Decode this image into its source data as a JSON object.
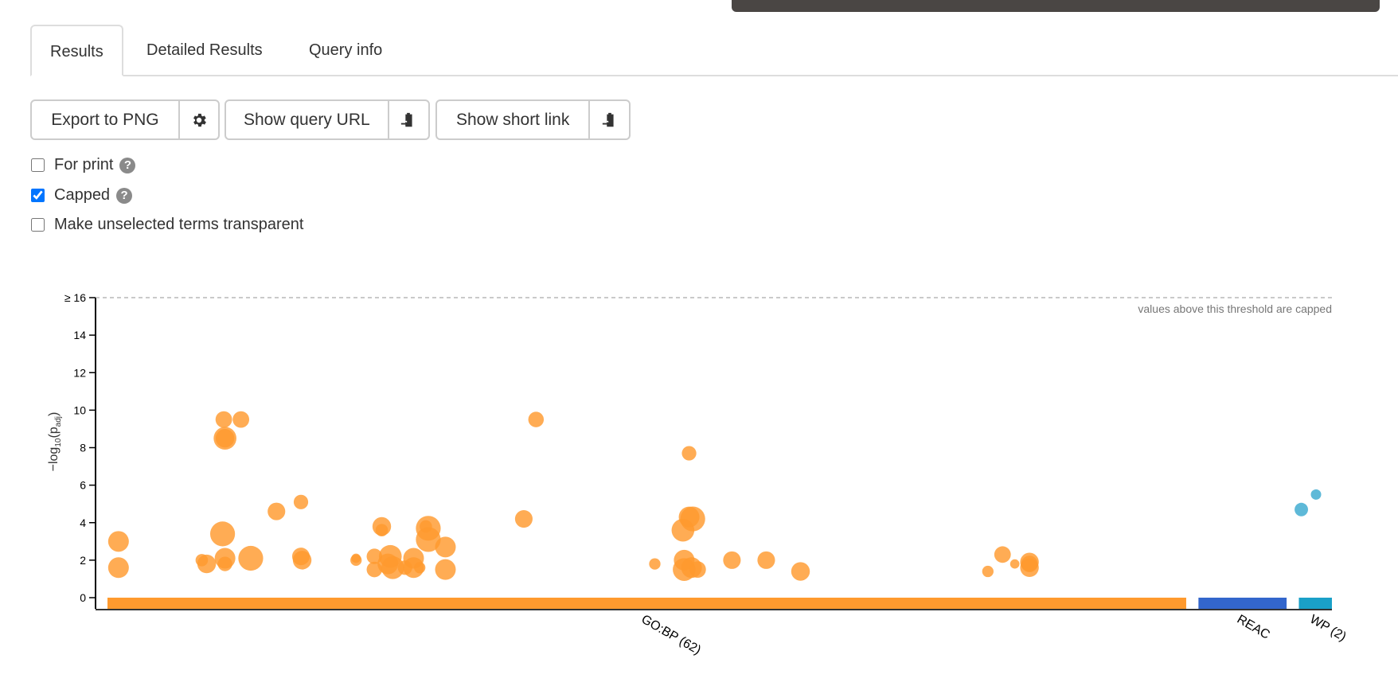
{
  "tabs": [
    {
      "label": "Results",
      "active": true
    },
    {
      "label": "Detailed Results",
      "active": false
    },
    {
      "label": "Query info",
      "active": false
    }
  ],
  "toolbar": {
    "export_label": "Export to PNG",
    "export_icon": "gear-icon",
    "query_url_label": "Show query URL",
    "query_url_icon": "clipboard-icon",
    "short_link_label": "Show short link",
    "short_link_icon": "clipboard-icon"
  },
  "options": {
    "for_print": {
      "label": "For print",
      "checked": false,
      "help": "?"
    },
    "capped": {
      "label": "Capped",
      "checked": true,
      "help": "?"
    },
    "transparent": {
      "label": "Make unselected terms transparent",
      "checked": false
    }
  },
  "chart_data": {
    "type": "scatter",
    "title": "",
    "ylabel": "-log10(p_adj)",
    "ylabel_main": "−log",
    "ylabel_sub": "10",
    "ylabel_paren": "(p",
    "ylabel_sub2": "adj",
    "ylabel_close": ")",
    "ylim": [
      0,
      16
    ],
    "yticks": [
      0,
      2,
      4,
      6,
      8,
      10,
      12,
      14,
      16
    ],
    "ytick_labels": [
      "0",
      "2",
      "4",
      "6",
      "8",
      "10",
      "12",
      "14",
      "≥ 16"
    ],
    "threshold": 16,
    "threshold_label": "values above this threshold are capped",
    "grid": false,
    "sources": [
      {
        "name": "GO:BP",
        "label": "GO:BP (62)",
        "color": "#ff9a2e",
        "start": 0.0,
        "end": 0.881
      },
      {
        "name": "REAC",
        "label": "REAC",
        "color": "#3366cc",
        "start": 0.891,
        "end": 0.963
      },
      {
        "name": "WP",
        "label": "WP (2)",
        "color": "#1aa0c8",
        "start": 0.973,
        "end": 1.0
      }
    ],
    "points": [
      {
        "source": "GO:BP",
        "x": 0.009,
        "y": 3.0,
        "size": 1.0
      },
      {
        "source": "GO:BP",
        "x": 0.009,
        "y": 1.6,
        "size": 1.0
      },
      {
        "source": "GO:BP",
        "x": 0.077,
        "y": 2.0,
        "size": 0.6
      },
      {
        "source": "GO:BP",
        "x": 0.081,
        "y": 1.8,
        "size": 0.9
      },
      {
        "source": "GO:BP",
        "x": 0.095,
        "y": 9.5,
        "size": 0.8
      },
      {
        "source": "GO:BP",
        "x": 0.096,
        "y": 8.5,
        "size": 1.1
      },
      {
        "source": "GO:BP",
        "x": 0.096,
        "y": 8.5,
        "size": 0.9
      },
      {
        "source": "GO:BP",
        "x": 0.094,
        "y": 3.4,
        "size": 1.2
      },
      {
        "source": "GO:BP",
        "x": 0.096,
        "y": 2.1,
        "size": 1.0
      },
      {
        "source": "GO:BP",
        "x": 0.096,
        "y": 1.8,
        "size": 0.7
      },
      {
        "source": "GO:BP",
        "x": 0.109,
        "y": 9.5,
        "size": 0.8
      },
      {
        "source": "GO:BP",
        "x": 0.117,
        "y": 2.1,
        "size": 1.2
      },
      {
        "source": "GO:BP",
        "x": 0.138,
        "y": 4.6,
        "size": 0.85
      },
      {
        "source": "GO:BP",
        "x": 0.158,
        "y": 5.1,
        "size": 0.7
      },
      {
        "source": "GO:BP",
        "x": 0.158,
        "y": 2.2,
        "size": 0.85
      },
      {
        "source": "GO:BP",
        "x": 0.159,
        "y": 2.0,
        "size": 0.9
      },
      {
        "source": "GO:BP",
        "x": 0.203,
        "y": 2.0,
        "size": 0.55
      },
      {
        "source": "GO:BP",
        "x": 0.203,
        "y": 2.1,
        "size": 0.45
      },
      {
        "source": "GO:BP",
        "x": 0.224,
        "y": 3.8,
        "size": 0.9
      },
      {
        "source": "GO:BP",
        "x": 0.224,
        "y": 3.6,
        "size": 0.6
      },
      {
        "source": "GO:BP",
        "x": 0.218,
        "y": 2.2,
        "size": 0.75
      },
      {
        "source": "GO:BP",
        "x": 0.218,
        "y": 1.5,
        "size": 0.75
      },
      {
        "source": "GO:BP",
        "x": 0.231,
        "y": 2.2,
        "size": 1.1
      },
      {
        "source": "GO:BP",
        "x": 0.233,
        "y": 1.6,
        "size": 1.1
      },
      {
        "source": "GO:BP",
        "x": 0.229,
        "y": 1.8,
        "size": 1.0
      },
      {
        "source": "GO:BP",
        "x": 0.243,
        "y": 1.6,
        "size": 0.7
      },
      {
        "source": "GO:BP",
        "x": 0.25,
        "y": 2.1,
        "size": 1.0
      },
      {
        "source": "GO:BP",
        "x": 0.25,
        "y": 1.6,
        "size": 1.0
      },
      {
        "source": "GO:BP",
        "x": 0.255,
        "y": 1.6,
        "size": 0.55
      },
      {
        "source": "GO:BP",
        "x": 0.262,
        "y": 3.7,
        "size": 1.2
      },
      {
        "source": "GO:BP",
        "x": 0.262,
        "y": 3.1,
        "size": 1.2
      },
      {
        "source": "GO:BP",
        "x": 0.26,
        "y": 3.8,
        "size": 0.6
      },
      {
        "source": "GO:BP",
        "x": 0.276,
        "y": 2.7,
        "size": 1.0
      },
      {
        "source": "GO:BP",
        "x": 0.276,
        "y": 1.5,
        "size": 1.0
      },
      {
        "source": "GO:BP",
        "x": 0.34,
        "y": 4.2,
        "size": 0.85
      },
      {
        "source": "GO:BP",
        "x": 0.35,
        "y": 9.5,
        "size": 0.75
      },
      {
        "source": "GO:BP",
        "x": 0.447,
        "y": 1.8,
        "size": 0.55
      },
      {
        "source": "GO:BP",
        "x": 0.475,
        "y": 7.7,
        "size": 0.7
      },
      {
        "source": "GO:BP",
        "x": 0.47,
        "y": 3.6,
        "size": 1.1
      },
      {
        "source": "GO:BP",
        "x": 0.478,
        "y": 4.2,
        "size": 1.2
      },
      {
        "source": "GO:BP",
        "x": 0.475,
        "y": 4.3,
        "size": 1.0
      },
      {
        "source": "GO:BP",
        "x": 0.471,
        "y": 2.0,
        "size": 1.0
      },
      {
        "source": "GO:BP",
        "x": 0.471,
        "y": 1.5,
        "size": 1.1
      },
      {
        "source": "GO:BP",
        "x": 0.477,
        "y": 1.6,
        "size": 1.0
      },
      {
        "source": "GO:BP",
        "x": 0.482,
        "y": 1.5,
        "size": 0.8
      },
      {
        "source": "GO:BP",
        "x": 0.51,
        "y": 2.0,
        "size": 0.85
      },
      {
        "source": "GO:BP",
        "x": 0.538,
        "y": 2.0,
        "size": 0.85
      },
      {
        "source": "GO:BP",
        "x": 0.566,
        "y": 1.4,
        "size": 0.9
      },
      {
        "source": "GO:BP",
        "x": 0.719,
        "y": 1.4,
        "size": 0.55
      },
      {
        "source": "GO:BP",
        "x": 0.731,
        "y": 2.3,
        "size": 0.8
      },
      {
        "source": "GO:BP",
        "x": 0.741,
        "y": 1.8,
        "size": 0.45
      },
      {
        "source": "GO:BP",
        "x": 0.753,
        "y": 1.9,
        "size": 0.9
      },
      {
        "source": "GO:BP",
        "x": 0.753,
        "y": 1.6,
        "size": 0.9
      },
      {
        "source": "GO:BP",
        "x": 0.753,
        "y": 1.8,
        "size": 0.8
      },
      {
        "source": "WP",
        "x": 0.975,
        "y": 4.7,
        "size": 0.65
      },
      {
        "source": "WP",
        "x": 0.987,
        "y": 5.5,
        "size": 0.5
      }
    ],
    "xlabel": ""
  }
}
